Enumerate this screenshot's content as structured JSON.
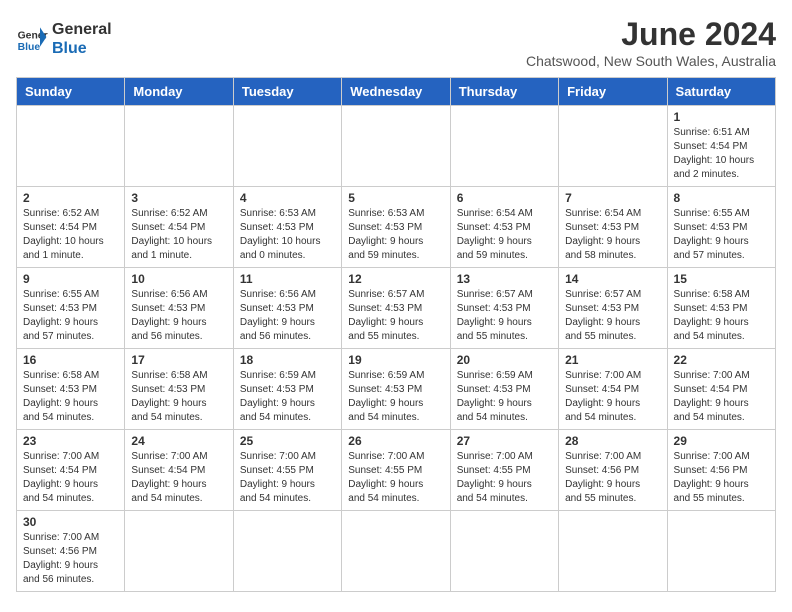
{
  "logo": {
    "line1": "General",
    "line2": "Blue"
  },
  "title": "June 2024",
  "location": "Chatswood, New South Wales, Australia",
  "weekdays": [
    "Sunday",
    "Monday",
    "Tuesday",
    "Wednesday",
    "Thursday",
    "Friday",
    "Saturday"
  ],
  "weeks": [
    [
      {
        "day": "",
        "info": ""
      },
      {
        "day": "",
        "info": ""
      },
      {
        "day": "",
        "info": ""
      },
      {
        "day": "",
        "info": ""
      },
      {
        "day": "",
        "info": ""
      },
      {
        "day": "",
        "info": ""
      },
      {
        "day": "1",
        "info": "Sunrise: 6:51 AM\nSunset: 4:54 PM\nDaylight: 10 hours\nand 2 minutes."
      }
    ],
    [
      {
        "day": "2",
        "info": "Sunrise: 6:52 AM\nSunset: 4:54 PM\nDaylight: 10 hours\nand 1 minute."
      },
      {
        "day": "3",
        "info": "Sunrise: 6:52 AM\nSunset: 4:54 PM\nDaylight: 10 hours\nand 1 minute."
      },
      {
        "day": "4",
        "info": "Sunrise: 6:53 AM\nSunset: 4:53 PM\nDaylight: 10 hours\nand 0 minutes."
      },
      {
        "day": "5",
        "info": "Sunrise: 6:53 AM\nSunset: 4:53 PM\nDaylight: 9 hours\nand 59 minutes."
      },
      {
        "day": "6",
        "info": "Sunrise: 6:54 AM\nSunset: 4:53 PM\nDaylight: 9 hours\nand 59 minutes."
      },
      {
        "day": "7",
        "info": "Sunrise: 6:54 AM\nSunset: 4:53 PM\nDaylight: 9 hours\nand 58 minutes."
      },
      {
        "day": "8",
        "info": "Sunrise: 6:55 AM\nSunset: 4:53 PM\nDaylight: 9 hours\nand 57 minutes."
      }
    ],
    [
      {
        "day": "9",
        "info": "Sunrise: 6:55 AM\nSunset: 4:53 PM\nDaylight: 9 hours\nand 57 minutes."
      },
      {
        "day": "10",
        "info": "Sunrise: 6:56 AM\nSunset: 4:53 PM\nDaylight: 9 hours\nand 56 minutes."
      },
      {
        "day": "11",
        "info": "Sunrise: 6:56 AM\nSunset: 4:53 PM\nDaylight: 9 hours\nand 56 minutes."
      },
      {
        "day": "12",
        "info": "Sunrise: 6:57 AM\nSunset: 4:53 PM\nDaylight: 9 hours\nand 55 minutes."
      },
      {
        "day": "13",
        "info": "Sunrise: 6:57 AM\nSunset: 4:53 PM\nDaylight: 9 hours\nand 55 minutes."
      },
      {
        "day": "14",
        "info": "Sunrise: 6:57 AM\nSunset: 4:53 PM\nDaylight: 9 hours\nand 55 minutes."
      },
      {
        "day": "15",
        "info": "Sunrise: 6:58 AM\nSunset: 4:53 PM\nDaylight: 9 hours\nand 54 minutes."
      }
    ],
    [
      {
        "day": "16",
        "info": "Sunrise: 6:58 AM\nSunset: 4:53 PM\nDaylight: 9 hours\nand 54 minutes."
      },
      {
        "day": "17",
        "info": "Sunrise: 6:58 AM\nSunset: 4:53 PM\nDaylight: 9 hours\nand 54 minutes."
      },
      {
        "day": "18",
        "info": "Sunrise: 6:59 AM\nSunset: 4:53 PM\nDaylight: 9 hours\nand 54 minutes."
      },
      {
        "day": "19",
        "info": "Sunrise: 6:59 AM\nSunset: 4:53 PM\nDaylight: 9 hours\nand 54 minutes."
      },
      {
        "day": "20",
        "info": "Sunrise: 6:59 AM\nSunset: 4:53 PM\nDaylight: 9 hours\nand 54 minutes."
      },
      {
        "day": "21",
        "info": "Sunrise: 7:00 AM\nSunset: 4:54 PM\nDaylight: 9 hours\nand 54 minutes."
      },
      {
        "day": "22",
        "info": "Sunrise: 7:00 AM\nSunset: 4:54 PM\nDaylight: 9 hours\nand 54 minutes."
      }
    ],
    [
      {
        "day": "23",
        "info": "Sunrise: 7:00 AM\nSunset: 4:54 PM\nDaylight: 9 hours\nand 54 minutes."
      },
      {
        "day": "24",
        "info": "Sunrise: 7:00 AM\nSunset: 4:54 PM\nDaylight: 9 hours\nand 54 minutes."
      },
      {
        "day": "25",
        "info": "Sunrise: 7:00 AM\nSunset: 4:55 PM\nDaylight: 9 hours\nand 54 minutes."
      },
      {
        "day": "26",
        "info": "Sunrise: 7:00 AM\nSunset: 4:55 PM\nDaylight: 9 hours\nand 54 minutes."
      },
      {
        "day": "27",
        "info": "Sunrise: 7:00 AM\nSunset: 4:55 PM\nDaylight: 9 hours\nand 54 minutes."
      },
      {
        "day": "28",
        "info": "Sunrise: 7:00 AM\nSunset: 4:56 PM\nDaylight: 9 hours\nand 55 minutes."
      },
      {
        "day": "29",
        "info": "Sunrise: 7:00 AM\nSunset: 4:56 PM\nDaylight: 9 hours\nand 55 minutes."
      }
    ],
    [
      {
        "day": "30",
        "info": "Sunrise: 7:00 AM\nSunset: 4:56 PM\nDaylight: 9 hours\nand 56 minutes."
      },
      {
        "day": "",
        "info": ""
      },
      {
        "day": "",
        "info": ""
      },
      {
        "day": "",
        "info": ""
      },
      {
        "day": "",
        "info": ""
      },
      {
        "day": "",
        "info": ""
      },
      {
        "day": "",
        "info": ""
      }
    ]
  ]
}
